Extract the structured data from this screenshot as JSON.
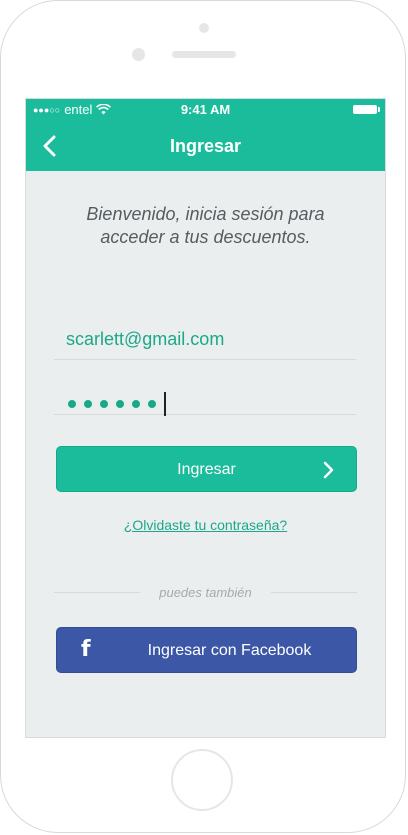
{
  "status_bar": {
    "carrier": "entel",
    "signal_dots": "●●●○○",
    "time": "9:41 AM"
  },
  "nav": {
    "title": "Ingresar"
  },
  "welcome": {
    "line1": "Bienvenido, inicia sesión para",
    "line2": "acceder a tus descuentos."
  },
  "form": {
    "email_value": "scarlett@gmail.com",
    "password_masked_length": 6
  },
  "buttons": {
    "login_label": "Ingresar",
    "forgot_label": "¿Olvidaste tu contraseña?",
    "divider_text": "puedes también",
    "facebook_label": "Ingresar con Facebook",
    "facebook_glyph": "f"
  },
  "colors": {
    "accent": "#1bbc9b",
    "facebook": "#3b57a6",
    "background": "#ebeeef"
  }
}
